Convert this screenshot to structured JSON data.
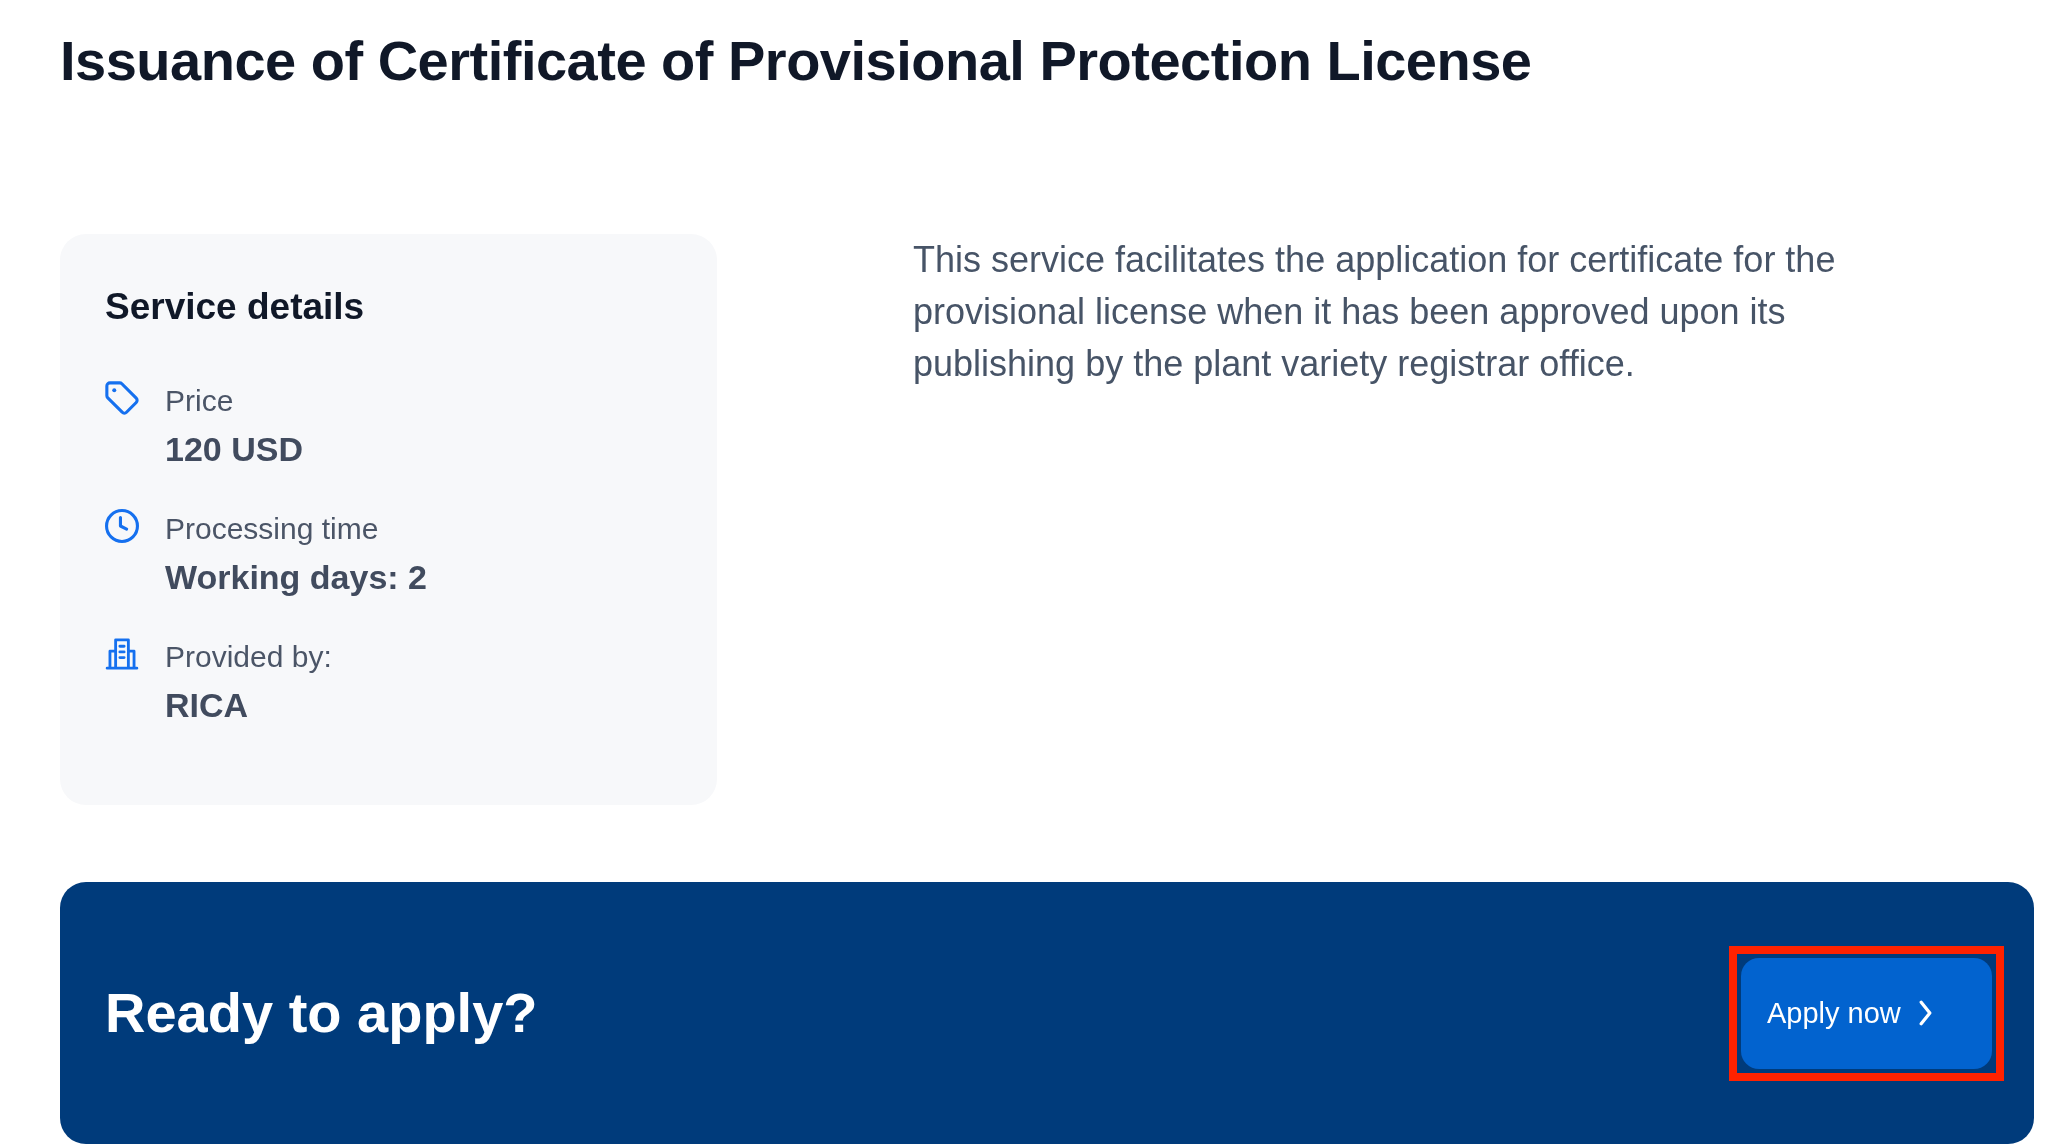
{
  "page": {
    "title": "Issuance of Certificate of Provisional Protection License"
  },
  "service_details": {
    "heading": "Service details",
    "items": [
      {
        "kind": "price",
        "label": "Price",
        "value": "120 USD"
      },
      {
        "kind": "time",
        "label": "Processing time",
        "value": "Working days: 2"
      },
      {
        "kind": "provider",
        "label": "Provided by:",
        "value": "RICA"
      }
    ]
  },
  "description": "This service facilitates the application for certificate for the provisional license when it has been approved upon its publishing by the plant variety registrar office.",
  "cta": {
    "heading": "Ready to apply?",
    "button": {
      "label": "Apply now",
      "highlighted": true
    }
  }
}
